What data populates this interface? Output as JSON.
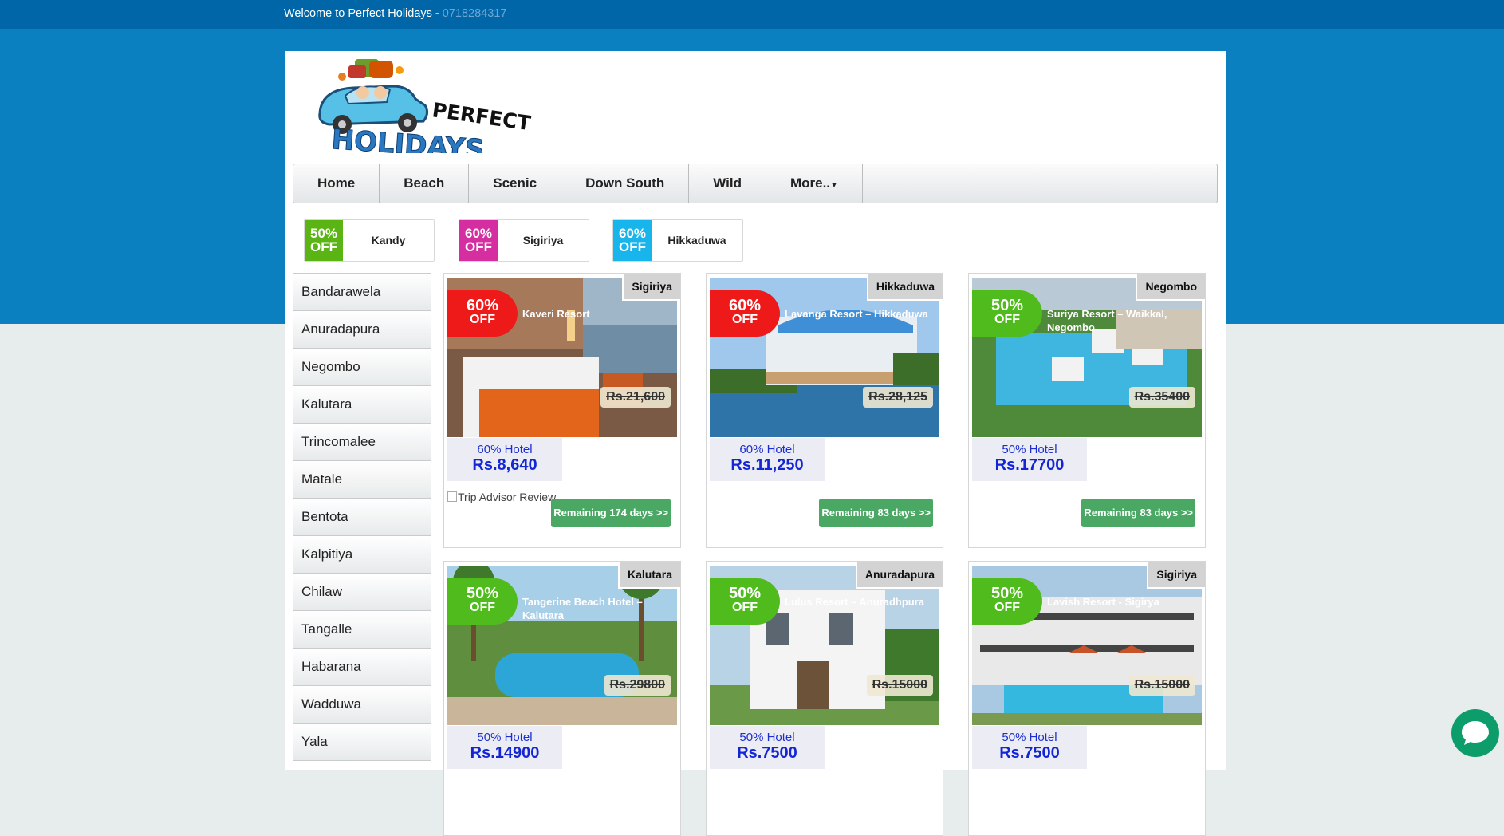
{
  "topbar": {
    "welcome": "Welcome to Perfect Holidays - ",
    "phone": "0718284317"
  },
  "logo": {
    "line1": "PERFECT",
    "line2": "HOLIDAYS"
  },
  "nav": [
    {
      "label": "Home"
    },
    {
      "label": "Beach"
    },
    {
      "label": "Scenic"
    },
    {
      "label": "Down South"
    },
    {
      "label": "Wild"
    },
    {
      "label": "More.."
    }
  ],
  "promos": [
    {
      "pct": "50%",
      "off": "OFF",
      "city": "Kandy",
      "color": "#5ab514"
    },
    {
      "pct": "60%",
      "off": "OFF",
      "city": "Sigiriya",
      "color": "#d42ea0"
    },
    {
      "pct": "60%",
      "off": "OFF",
      "city": "Hikkaduwa",
      "color": "#18b5ec"
    }
  ],
  "sidebar": [
    "Bandarawela",
    "Anuradapura",
    "Negombo",
    "Kalutara",
    "Trincomalee",
    "Matale",
    "Bentota",
    "Kalpitiya",
    "Chilaw",
    "Tangalle",
    "Habarana",
    "Wadduwa",
    "Yala"
  ],
  "colors": {
    "red_badge": "#ee1a1a",
    "green_badge": "#4fbb1c",
    "remain_button": "#4aa864",
    "price": "#1326d6"
  },
  "cards": [
    {
      "location": "Sigiriya",
      "pct": "60%",
      "off": "OFF",
      "badge": "red",
      "name": "Kaveri Resort",
      "old_price": "Rs.21,600",
      "label": "60% Hotel",
      "price": "Rs.8,640",
      "trip": "Trip Advisor Review",
      "remaining": "Remaining 174 days >>"
    },
    {
      "location": "Hikkaduwa",
      "pct": "60%",
      "off": "OFF",
      "badge": "red",
      "name": "Lavanga Resort – Hikkaduwa",
      "old_price": "Rs.28,125",
      "label": "60% Hotel",
      "price": "Rs.11,250",
      "remaining": "Remaining 83 days >>"
    },
    {
      "location": "Negombo",
      "pct": "50%",
      "off": "OFF",
      "badge": "green",
      "name": "Suriya Resort – Waikkal, Negombo",
      "old_price": "Rs.35400",
      "label": "50% Hotel",
      "price": "Rs.17700",
      "remaining": "Remaining 83 days >>"
    },
    {
      "location": "Kalutara",
      "pct": "50%",
      "off": "OFF",
      "badge": "green",
      "name": "Tangerine Beach Hotel – Kalutara",
      "old_price": "Rs.29800",
      "label": "50% Hotel",
      "price": "Rs.14900"
    },
    {
      "location": "Anuradapura",
      "pct": "50%",
      "off": "OFF",
      "badge": "green",
      "name": "Lulus Resort – Anuradhpura",
      "old_price": "Rs.15000",
      "label": "50% Hotel",
      "price": "Rs.7500"
    },
    {
      "location": "Sigiriya",
      "pct": "50%",
      "off": "OFF",
      "badge": "green",
      "name": "Lavish Resort - Sigirya",
      "old_price": "Rs.15000",
      "label": "50% Hotel",
      "price": "Rs.7500"
    }
  ],
  "chat": {
    "icon": "chat-bubble-icon"
  }
}
